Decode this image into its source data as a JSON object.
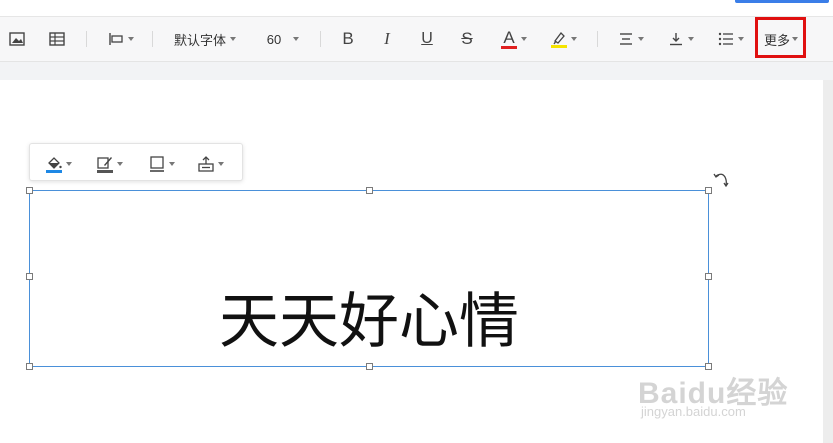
{
  "toolbar": {
    "font_family": "默认字体",
    "font_size": "60",
    "bold_label": "B",
    "italic_label": "I",
    "underline_label": "U",
    "strike_label": "S",
    "font_color_label": "A",
    "more_label": "更多",
    "font_color": "#e02020",
    "highlight_color": "#f5e400"
  },
  "floating_toolbar": {
    "fill_color": "#1e88e5",
    "border_color": "#555555"
  },
  "textbox": {
    "text": "天天好心情"
  },
  "watermark": {
    "logo": "Baidu经验",
    "url": "jingyan.baidu.com"
  }
}
